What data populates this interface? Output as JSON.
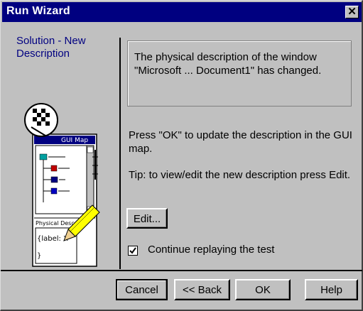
{
  "window": {
    "title": "Run Wizard",
    "close_glyph": "✕"
  },
  "sidebar": {
    "solution_label": "Solution - New Description",
    "illustration": {
      "gui_map_label": "GUI Map",
      "physical_desc_label": "Physical Desc...",
      "label_text": "{label: X",
      "closing_brace": "}",
      "icons": [
        "checkered-flag-icon",
        "pencil-icon"
      ]
    }
  },
  "main": {
    "message": "The physical description of the window \"Microsoft ... Document1\" has changed.",
    "instruction": "Press \"OK\" to update the description in the GUI map.",
    "tip": "Tip: to view/edit the new description press Edit.",
    "edit_button": "Edit...",
    "continue_checkbox": {
      "label": "Continue replaying the test",
      "checked": true
    }
  },
  "footer": {
    "cancel": "Cancel",
    "back": "<< Back",
    "ok": "OK",
    "help": "Help"
  },
  "colors": {
    "titlebar": "#000080",
    "dialog_bg": "#c0c0c0",
    "accent_text": "#000080",
    "pencil": "#ffff00"
  }
}
